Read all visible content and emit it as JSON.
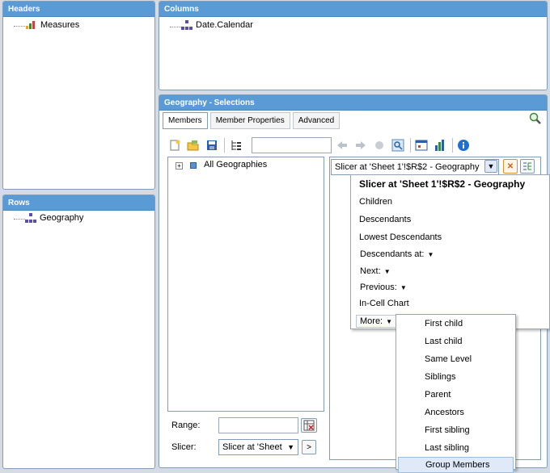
{
  "headers_panel": {
    "title": "Headers",
    "items": [
      {
        "label": "Measures",
        "icon": "bar-chart-icon"
      }
    ]
  },
  "columns_panel": {
    "title": "Columns",
    "items": [
      {
        "label": "Date.Calendar",
        "icon": "hierarchy-icon"
      }
    ]
  },
  "rows_panel": {
    "title": "Rows",
    "items": [
      {
        "label": "Geography",
        "icon": "hierarchy-icon"
      }
    ]
  },
  "selections_panel": {
    "title": "Geography - Selections",
    "tabs": [
      {
        "label": "Members"
      },
      {
        "label": "Member Properties"
      },
      {
        "label": "Advanced"
      }
    ],
    "search_value": "",
    "tree_root": "All Geographies",
    "range_label": "Range:",
    "range_value": "",
    "slicer_label": "Slicer:",
    "slicer_value": "Slicer at 'Sheet",
    "go_label": ">",
    "selection_combo_value": "Slicer at 'Sheet 1'!$R$2 - Geography"
  },
  "context_menu": {
    "header": "Slicer at  'Sheet 1'!$R$2 - Geography",
    "items": [
      {
        "label": "Children"
      },
      {
        "label": "Descendants"
      },
      {
        "label": "Lowest Descendants"
      },
      {
        "label": "Descendants at:"
      },
      {
        "label": "Next:"
      },
      {
        "label": "Previous:"
      },
      {
        "label": "In-Cell Chart"
      },
      {
        "label": "More:"
      }
    ]
  },
  "more_submenu": {
    "items": [
      {
        "label": "First child"
      },
      {
        "label": "Last child"
      },
      {
        "label": "Same Level"
      },
      {
        "label": "Siblings"
      },
      {
        "label": "Parent"
      },
      {
        "label": "Ancestors"
      },
      {
        "label": "First sibling"
      },
      {
        "label": "Last sibling"
      },
      {
        "label": "Group Members"
      }
    ]
  },
  "colors": {
    "header_blue": "#5b9bd5",
    "panel_border": "#7f9db9",
    "background": "#d4dbe5",
    "highlight": "#dfe9f7"
  }
}
